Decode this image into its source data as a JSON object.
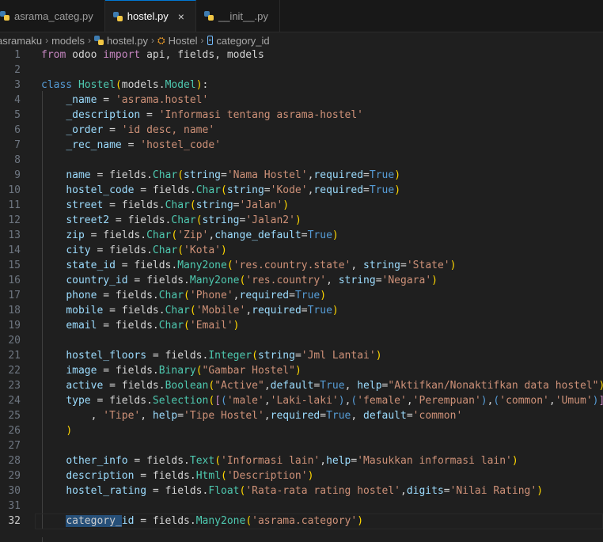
{
  "tabs": [
    {
      "label": "asrama_categ.py",
      "active": false
    },
    {
      "label": "hostel.py",
      "active": true,
      "close": "×"
    },
    {
      "label": "__init__.py",
      "active": false
    }
  ],
  "breadcrumb": [
    "asramaku",
    "models",
    "hostel.py",
    "Hostel",
    "category_id"
  ],
  "current_line": 32,
  "lines": [
    {
      "n": "1"
    },
    {
      "n": "2"
    },
    {
      "n": "3"
    },
    {
      "n": "4"
    },
    {
      "n": "5"
    },
    {
      "n": "6"
    },
    {
      "n": "7"
    },
    {
      "n": "8"
    },
    {
      "n": "9"
    },
    {
      "n": "10"
    },
    {
      "n": "11"
    },
    {
      "n": "12"
    },
    {
      "n": "13"
    },
    {
      "n": "14"
    },
    {
      "n": "15"
    },
    {
      "n": "16"
    },
    {
      "n": "17"
    },
    {
      "n": "18"
    },
    {
      "n": "19"
    },
    {
      "n": "20"
    },
    {
      "n": "21"
    },
    {
      "n": "22"
    },
    {
      "n": "23"
    },
    {
      "n": "24"
    },
    {
      "n": "25"
    },
    {
      "n": "26"
    },
    {
      "n": "27"
    },
    {
      "n": "28"
    },
    {
      "n": "29"
    },
    {
      "n": "30"
    },
    {
      "n": "31"
    },
    {
      "n": "32"
    }
  ],
  "code": [
    [
      [
        "kw",
        "from"
      ],
      [
        "op",
        " odoo "
      ],
      [
        "kw",
        "import"
      ],
      [
        "op",
        " api, fields, models"
      ]
    ],
    [],
    [
      [
        "dk",
        "class"
      ],
      [
        "op",
        " "
      ],
      [
        "ty",
        "Hostel"
      ],
      [
        "pr",
        "("
      ],
      [
        "op",
        "models."
      ],
      [
        "ty",
        "Model"
      ],
      [
        "pr",
        ")"
      ],
      [
        "op",
        ":"
      ]
    ],
    [
      [
        "op",
        "    "
      ],
      [
        "va",
        "_name"
      ],
      [
        "op",
        " = "
      ],
      [
        "st",
        "'asrama.hostel'"
      ]
    ],
    [
      [
        "op",
        "    "
      ],
      [
        "va",
        "_description"
      ],
      [
        "op",
        " = "
      ],
      [
        "st",
        "'Informasi tentang asrama-hostel'"
      ]
    ],
    [
      [
        "op",
        "    "
      ],
      [
        "va",
        "_order"
      ],
      [
        "op",
        " = "
      ],
      [
        "st",
        "'id desc, name'"
      ]
    ],
    [
      [
        "op",
        "    "
      ],
      [
        "va",
        "_rec_name"
      ],
      [
        "op",
        " = "
      ],
      [
        "st",
        "'hostel_code'"
      ]
    ],
    [],
    [
      [
        "op",
        "    "
      ],
      [
        "va",
        "name"
      ],
      [
        "op",
        " = fields."
      ],
      [
        "ty",
        "Char"
      ],
      [
        "pr",
        "("
      ],
      [
        "va",
        "string"
      ],
      [
        "op",
        "="
      ],
      [
        "st",
        "'Nama Hostel'"
      ],
      [
        "op",
        ","
      ],
      [
        "va",
        "required"
      ],
      [
        "op",
        "="
      ],
      [
        "dk",
        "True"
      ],
      [
        "pr",
        ")"
      ]
    ],
    [
      [
        "op",
        "    "
      ],
      [
        "va",
        "hostel_code"
      ],
      [
        "op",
        " = fields."
      ],
      [
        "ty",
        "Char"
      ],
      [
        "pr",
        "("
      ],
      [
        "va",
        "string"
      ],
      [
        "op",
        "="
      ],
      [
        "st",
        "'Kode'"
      ],
      [
        "op",
        ","
      ],
      [
        "va",
        "required"
      ],
      [
        "op",
        "="
      ],
      [
        "dk",
        "True"
      ],
      [
        "pr",
        ")"
      ]
    ],
    [
      [
        "op",
        "    "
      ],
      [
        "va",
        "street"
      ],
      [
        "op",
        " = fields."
      ],
      [
        "ty",
        "Char"
      ],
      [
        "pr",
        "("
      ],
      [
        "va",
        "string"
      ],
      [
        "op",
        "="
      ],
      [
        "st",
        "'Jalan'"
      ],
      [
        "pr",
        ")"
      ]
    ],
    [
      [
        "op",
        "    "
      ],
      [
        "va",
        "street2"
      ],
      [
        "op",
        " = fields."
      ],
      [
        "ty",
        "Char"
      ],
      [
        "pr",
        "("
      ],
      [
        "va",
        "string"
      ],
      [
        "op",
        "="
      ],
      [
        "st",
        "'Jalan2'"
      ],
      [
        "pr",
        ")"
      ]
    ],
    [
      [
        "op",
        "    "
      ],
      [
        "va",
        "zip"
      ],
      [
        "op",
        " = fields."
      ],
      [
        "ty",
        "Char"
      ],
      [
        "pr",
        "("
      ],
      [
        "st",
        "'Zip'"
      ],
      [
        "op",
        ","
      ],
      [
        "va",
        "change_default"
      ],
      [
        "op",
        "="
      ],
      [
        "dk",
        "True"
      ],
      [
        "pr",
        ")"
      ]
    ],
    [
      [
        "op",
        "    "
      ],
      [
        "va",
        "city"
      ],
      [
        "op",
        " = fields."
      ],
      [
        "ty",
        "Char"
      ],
      [
        "pr",
        "("
      ],
      [
        "st",
        "'Kota'"
      ],
      [
        "pr",
        ")"
      ]
    ],
    [
      [
        "op",
        "    "
      ],
      [
        "va",
        "state_id"
      ],
      [
        "op",
        " = fields."
      ],
      [
        "ty",
        "Many2one"
      ],
      [
        "pr",
        "("
      ],
      [
        "st",
        "'res.country.state'"
      ],
      [
        "op",
        ", "
      ],
      [
        "va",
        "string"
      ],
      [
        "op",
        "="
      ],
      [
        "st",
        "'State'"
      ],
      [
        "pr",
        ")"
      ]
    ],
    [
      [
        "op",
        "    "
      ],
      [
        "va",
        "country_id"
      ],
      [
        "op",
        " = fields."
      ],
      [
        "ty",
        "Many2one"
      ],
      [
        "pr",
        "("
      ],
      [
        "st",
        "'res.country'"
      ],
      [
        "op",
        ", "
      ],
      [
        "va",
        "string"
      ],
      [
        "op",
        "="
      ],
      [
        "st",
        "'Negara'"
      ],
      [
        "pr",
        ")"
      ]
    ],
    [
      [
        "op",
        "    "
      ],
      [
        "va",
        "phone"
      ],
      [
        "op",
        " = fields."
      ],
      [
        "ty",
        "Char"
      ],
      [
        "pr",
        "("
      ],
      [
        "st",
        "'Phone'"
      ],
      [
        "op",
        ","
      ],
      [
        "va",
        "required"
      ],
      [
        "op",
        "="
      ],
      [
        "dk",
        "True"
      ],
      [
        "pr",
        ")"
      ]
    ],
    [
      [
        "op",
        "    "
      ],
      [
        "va",
        "mobile"
      ],
      [
        "op",
        " = fields."
      ],
      [
        "ty",
        "Char"
      ],
      [
        "pr",
        "("
      ],
      [
        "st",
        "'Mobile'"
      ],
      [
        "op",
        ","
      ],
      [
        "va",
        "required"
      ],
      [
        "op",
        "="
      ],
      [
        "dk",
        "True"
      ],
      [
        "pr",
        ")"
      ]
    ],
    [
      [
        "op",
        "    "
      ],
      [
        "va",
        "email"
      ],
      [
        "op",
        " = fields."
      ],
      [
        "ty",
        "Char"
      ],
      [
        "pr",
        "("
      ],
      [
        "st",
        "'Email'"
      ],
      [
        "pr",
        ")"
      ]
    ],
    [],
    [
      [
        "op",
        "    "
      ],
      [
        "va",
        "hostel_floors"
      ],
      [
        "op",
        " = fields."
      ],
      [
        "ty",
        "Integer"
      ],
      [
        "pr",
        "("
      ],
      [
        "va",
        "string"
      ],
      [
        "op",
        "="
      ],
      [
        "st",
        "'Jml Lantai'"
      ],
      [
        "pr",
        ")"
      ]
    ],
    [
      [
        "op",
        "    "
      ],
      [
        "va",
        "image"
      ],
      [
        "op",
        " = fields."
      ],
      [
        "ty",
        "Binary"
      ],
      [
        "pr",
        "("
      ],
      [
        "st",
        "\"Gambar Hostel\""
      ],
      [
        "pr",
        ")"
      ]
    ],
    [
      [
        "op",
        "    "
      ],
      [
        "va",
        "active"
      ],
      [
        "op",
        " = fields."
      ],
      [
        "ty",
        "Boolean"
      ],
      [
        "pr",
        "("
      ],
      [
        "st",
        "\"Active\""
      ],
      [
        "op",
        ","
      ],
      [
        "va",
        "default"
      ],
      [
        "op",
        "="
      ],
      [
        "dk",
        "True"
      ],
      [
        "op",
        ", "
      ],
      [
        "va",
        "help"
      ],
      [
        "op",
        "="
      ],
      [
        "st",
        "\"Aktifkan/Nonaktifkan data hostel\""
      ],
      [
        "pr",
        ")"
      ]
    ],
    [
      [
        "op",
        "    "
      ],
      [
        "va",
        "type"
      ],
      [
        "op",
        " = fields."
      ],
      [
        "ty",
        "Selection"
      ],
      [
        "pr",
        "("
      ],
      [
        "kw",
        "["
      ],
      [
        "dk",
        "("
      ],
      [
        "st",
        "'male'"
      ],
      [
        "op",
        ","
      ],
      [
        "st",
        "'Laki-laki'"
      ],
      [
        "dk",
        ")"
      ],
      [
        "op",
        ","
      ],
      [
        "dk",
        "("
      ],
      [
        "st",
        "'female'"
      ],
      [
        "op",
        ","
      ],
      [
        "st",
        "'Perempuan'"
      ],
      [
        "dk",
        ")"
      ],
      [
        "op",
        ","
      ],
      [
        "dk",
        "("
      ],
      [
        "st",
        "'common'"
      ],
      [
        "op",
        ","
      ],
      [
        "st",
        "'Umum'"
      ],
      [
        "dk",
        ")"
      ],
      [
        "kw",
        "]"
      ]
    ],
    [
      [
        "op",
        "        , "
      ],
      [
        "st",
        "'Tipe'"
      ],
      [
        "op",
        ", "
      ],
      [
        "va",
        "help"
      ],
      [
        "op",
        "="
      ],
      [
        "st",
        "'Tipe Hostel'"
      ],
      [
        "op",
        ","
      ],
      [
        "va",
        "required"
      ],
      [
        "op",
        "="
      ],
      [
        "dk",
        "True"
      ],
      [
        "op",
        ", "
      ],
      [
        "va",
        "default"
      ],
      [
        "op",
        "="
      ],
      [
        "st",
        "'common'"
      ]
    ],
    [
      [
        "op",
        "    "
      ],
      [
        "pr",
        ")"
      ]
    ],
    [],
    [
      [
        "op",
        "    "
      ],
      [
        "va",
        "other_info"
      ],
      [
        "op",
        " = fields."
      ],
      [
        "ty",
        "Text"
      ],
      [
        "pr",
        "("
      ],
      [
        "st",
        "'Informasi lain'"
      ],
      [
        "op",
        ","
      ],
      [
        "va",
        "help"
      ],
      [
        "op",
        "="
      ],
      [
        "st",
        "'Masukkan informasi lain'"
      ],
      [
        "pr",
        ")"
      ]
    ],
    [
      [
        "op",
        "    "
      ],
      [
        "va",
        "description"
      ],
      [
        "op",
        " = fields."
      ],
      [
        "ty",
        "Html"
      ],
      [
        "pr",
        "("
      ],
      [
        "st",
        "'Description'"
      ],
      [
        "pr",
        ")"
      ]
    ],
    [
      [
        "op",
        "    "
      ],
      [
        "va",
        "hostel_rating"
      ],
      [
        "op",
        " = fields."
      ],
      [
        "ty",
        "Float"
      ],
      [
        "pr",
        "("
      ],
      [
        "st",
        "'Rata-rata rating hostel'"
      ],
      [
        "op",
        ","
      ],
      [
        "va",
        "digits"
      ],
      [
        "op",
        "="
      ],
      [
        "st",
        "'Nilai Rating'"
      ],
      [
        "pr",
        ")"
      ]
    ],
    [],
    [
      [
        "op",
        "    "
      ],
      [
        "sel",
        "category_"
      ],
      [
        "va",
        "id"
      ],
      [
        "op",
        " = fields."
      ],
      [
        "ty",
        "Many2one"
      ],
      [
        "pr",
        "("
      ],
      [
        "st",
        "'asrama.category'"
      ],
      [
        "pr",
        ")"
      ]
    ]
  ]
}
